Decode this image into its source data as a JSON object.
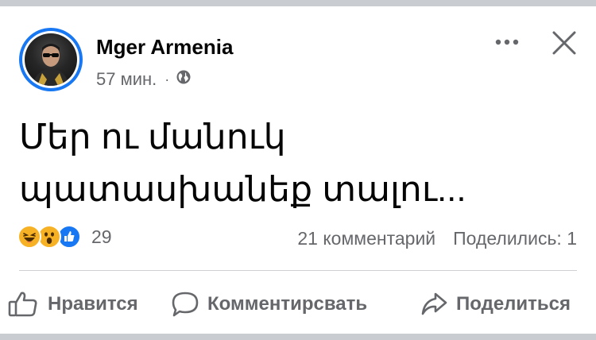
{
  "post": {
    "author": "Mger Armenia",
    "time": "57 мин.",
    "separator": "·",
    "privacy_icon": "globe-icon",
    "text_line1": "Մեր ու մանուկ",
    "text_line2": "պատասխանեք տալու..."
  },
  "header": {
    "more_icon": "more-options-icon",
    "close_icon": "close-icon"
  },
  "reactions": {
    "types": [
      "haha",
      "wow",
      "like"
    ],
    "count": "29"
  },
  "stats": {
    "comments": "21 комментарий",
    "shares": "Поделились: 1"
  },
  "actions": {
    "like": "Нравится",
    "comment": "Комментирсвать",
    "share": "Поделиться"
  },
  "colors": {
    "brand": "#1877f2",
    "secondary_text": "#65676b",
    "reaction_yellow": "#f7b125"
  }
}
